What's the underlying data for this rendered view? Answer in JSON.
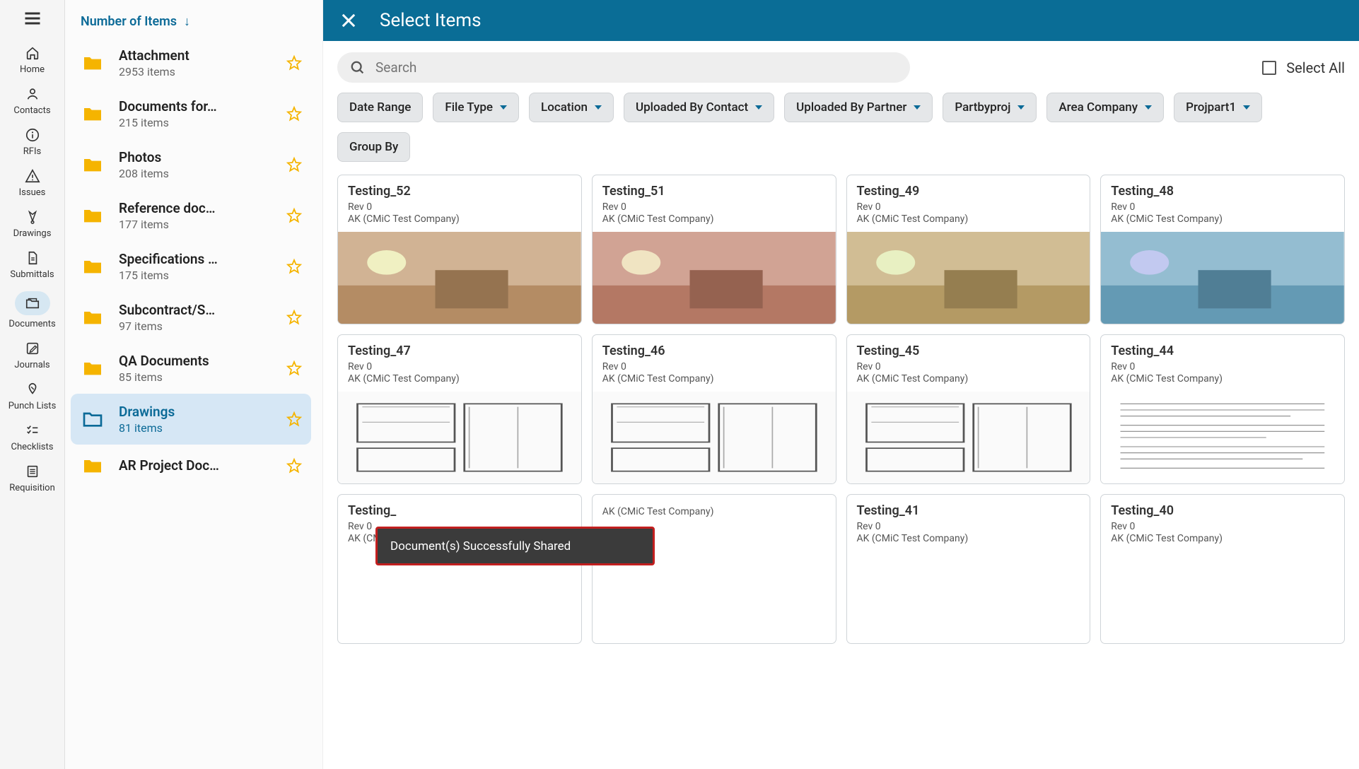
{
  "sidebar": {
    "items": [
      {
        "label": "Home",
        "icon": "home"
      },
      {
        "label": "Contacts",
        "icon": "person"
      },
      {
        "label": "RFIs",
        "icon": "info"
      },
      {
        "label": "Issues",
        "icon": "warning"
      },
      {
        "label": "Drawings",
        "icon": "compass"
      },
      {
        "label": "Submittals",
        "icon": "file"
      },
      {
        "label": "Documents",
        "icon": "folder"
      },
      {
        "label": "Journals",
        "icon": "edit"
      },
      {
        "label": "Punch Lists",
        "icon": "tag"
      },
      {
        "label": "Checklists",
        "icon": "checklist"
      },
      {
        "label": "Requisition",
        "icon": "list"
      }
    ],
    "activeIndex": 6
  },
  "folderPanel": {
    "sortLabel": "Number of Items",
    "folders": [
      {
        "name": "Attachment",
        "count": "2953 items"
      },
      {
        "name": "Documents for…",
        "count": "215 items"
      },
      {
        "name": "Photos",
        "count": "208 items"
      },
      {
        "name": "Reference doc…",
        "count": "177 items"
      },
      {
        "name": "Specifications …",
        "count": "175 items"
      },
      {
        "name": "Subcontract/S…",
        "count": "97 items"
      },
      {
        "name": "QA Documents",
        "count": "85 items"
      },
      {
        "name": "Drawings",
        "count": "81 items"
      },
      {
        "name": "AR Project Doc…",
        "count": ""
      }
    ],
    "selectedIndex": 7
  },
  "main": {
    "title": "Select Items",
    "search": {
      "placeholder": "Search"
    },
    "selectAllLabel": "Select All",
    "filters": [
      {
        "label": "Date Range",
        "dropdown": false
      },
      {
        "label": "File Type",
        "dropdown": true
      },
      {
        "label": "Location",
        "dropdown": true
      },
      {
        "label": "Uploaded By Contact",
        "dropdown": true
      },
      {
        "label": "Uploaded By Partner",
        "dropdown": true
      },
      {
        "label": "Partbyproj",
        "dropdown": true
      },
      {
        "label": "Area Company",
        "dropdown": true
      },
      {
        "label": "Projpart1",
        "dropdown": true
      },
      {
        "label": "Group By",
        "dropdown": false
      }
    ],
    "cards": [
      {
        "title": "Testing_52",
        "rev": "Rev 0",
        "company": "AK (CMiC Test Company)",
        "thumb": "photo1"
      },
      {
        "title": "Testing_51",
        "rev": "Rev 0",
        "company": "AK (CMiC Test Company)",
        "thumb": "photo2"
      },
      {
        "title": "Testing_49",
        "rev": "Rev 0",
        "company": "AK (CMiC Test Company)",
        "thumb": "photo3"
      },
      {
        "title": "Testing_48",
        "rev": "Rev 0",
        "company": "AK (CMiC Test Company)",
        "thumb": "photo4"
      },
      {
        "title": "Testing_47",
        "rev": "Rev 0",
        "company": "AK (CMiC Test Company)",
        "thumb": "plan1"
      },
      {
        "title": "Testing_46",
        "rev": "Rev 0",
        "company": "AK (CMiC Test Company)",
        "thumb": "plan2"
      },
      {
        "title": "Testing_45",
        "rev": "Rev 0",
        "company": "AK (CMiC Test Company)",
        "thumb": "plan3"
      },
      {
        "title": "Testing_44",
        "rev": "Rev 0",
        "company": "AK (CMiC Test Company)",
        "thumb": "doc1"
      },
      {
        "title": "Testing_",
        "rev": "Rev 0",
        "company": "AK (CMiC Test Company)",
        "thumb": ""
      },
      {
        "title": "",
        "rev": "",
        "company": "AK (CMiC Test Company)",
        "thumb": ""
      },
      {
        "title": "Testing_41",
        "rev": "Rev 0",
        "company": "AK (CMiC Test Company)",
        "thumb": ""
      },
      {
        "title": "Testing_40",
        "rev": "Rev 0",
        "company": "AK (CMiC Test Company)",
        "thumb": ""
      }
    ]
  },
  "toast": {
    "message": "Document(s) Successfully Shared"
  }
}
